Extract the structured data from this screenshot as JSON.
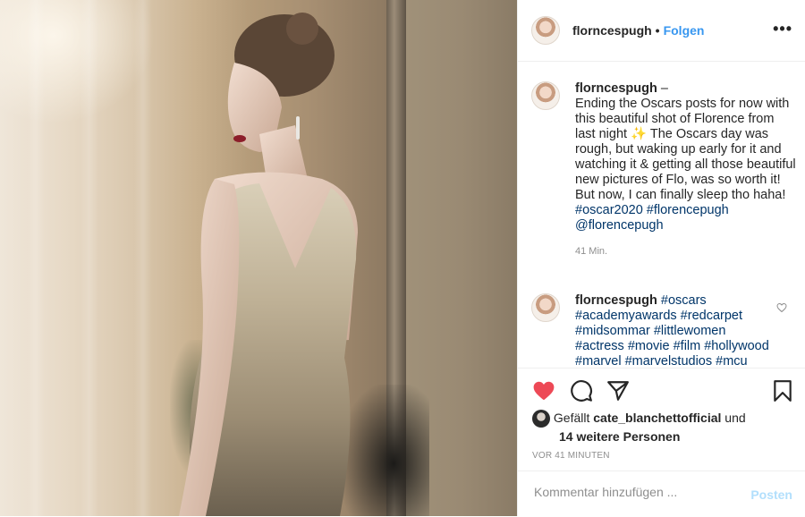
{
  "photo": {
    "alt": ""
  },
  "header": {
    "username": "florncespugh",
    "separator": "•",
    "follow_label": "Folgen",
    "more_label": "•••"
  },
  "comments": [
    {
      "username": "florncespugh",
      "text_prefix": " –",
      "text": "Ending the Oscars posts for now with this beautiful shot of Florence from last night ✨ The Oscars day was rough, but waking up early for it and watching it & getting all those beautiful new pictures of Flo, was so worth it! But now, I can finally sleep tho haha!",
      "tags": "#oscar2020 #florencepugh @florencepugh",
      "time": "41 Min."
    },
    {
      "username": "florncespugh",
      "tags": "#oscars #academyawards #redcarpet #midsommar #littlewomen #actress #movie #film #hollywood #marvel #marvelstudios #mcu"
    }
  ],
  "likes": {
    "prefix": "Gefällt",
    "user": "cate_blanchettofficial",
    "middle": "und",
    "others": "14 weitere Personen"
  },
  "timestamp": "VOR 41 MINUTEN",
  "add_comment": {
    "placeholder": "Kommentar hinzufügen ...",
    "post_label": "Posten"
  },
  "colors": {
    "link": "#3897f0",
    "liked": "#ed4956",
    "hashtag": "#003569",
    "post_disabled": "#b2dffc"
  }
}
